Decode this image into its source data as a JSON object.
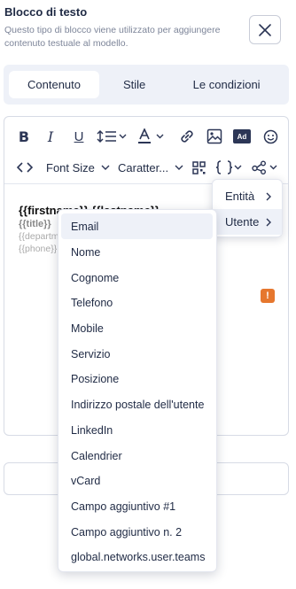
{
  "header": {
    "title": "Blocco di testo",
    "description": "Questo tipo di blocco viene utilizzato per aggiungere contenuto testuale al modello."
  },
  "tabs": [
    {
      "label": "Contenuto",
      "active": true
    },
    {
      "label": "Stile",
      "active": false
    },
    {
      "label": "Le condizioni",
      "active": false
    }
  ],
  "toolbar": {
    "font_size_label": "Font Size",
    "font_family_label": "Caratter...",
    "ad_label": "Ad"
  },
  "content": {
    "line1": "{{firstname}} {{lastname}}",
    "line2": "{{title}}",
    "line3": "{{department}}",
    "line4": "{{phone}}"
  },
  "submenu": {
    "items": [
      {
        "label": "Entità"
      },
      {
        "label": "Utente"
      }
    ]
  },
  "dropdown": {
    "options": [
      "Email",
      "Nome",
      "Cognome",
      "Telefono",
      "Mobile",
      "Servizio",
      "Posizione",
      "Indirizzo postale dell'utente",
      "LinkedIn",
      "Calendrier",
      "vCard",
      "Campo aggiuntivo #1",
      "Campo aggiuntivo n. 2",
      "global.networks.user.teams"
    ]
  },
  "colors": {
    "text": "#1f2a44",
    "tab_bg": "#eef1f8",
    "warning": "#e6772e"
  }
}
